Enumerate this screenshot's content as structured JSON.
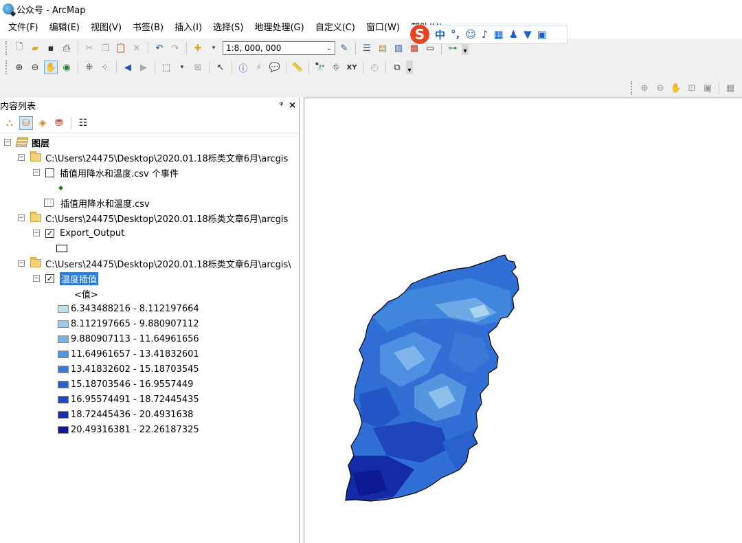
{
  "window": {
    "title": "公众号 - ArcMap"
  },
  "menu": [
    "文件(F)",
    "编辑(E)",
    "视图(V)",
    "书签(B)",
    "插入(I)",
    "选择(S)",
    "地理处理(G)",
    "自定义(C)",
    "窗口(W)",
    "帮助(H)"
  ],
  "ime": {
    "logo": "S",
    "mode": "中"
  },
  "toolbar": {
    "scale": "1:8, 000, 000"
  },
  "toc": {
    "title": "内容列表",
    "pin_glyph": "ᵠ",
    "close_glyph": "×",
    "root": "图层",
    "groups": [
      {
        "path": "C:\\Users\\24475\\Desktop\\2020.01.18栎类文章6月\\arcgis"
      },
      {
        "path": "C:\\Users\\24475\\Desktop\\2020.01.18栎类文章6月\\arcgis"
      },
      {
        "path": "C:\\Users\\24475\\Desktop\\2020.01.18栎类文章6月\\arcgis\\"
      }
    ],
    "events_layer": "插值用降水和温度.csv 个事件",
    "csv_table": "插值用降水和温度.csv",
    "export_layer": "Export_Output",
    "raster_layer": "温度插值",
    "value_heading": "<值>",
    "classes": [
      {
        "label": "6.343488216 - 8.112197664",
        "color": "#b5e3ec"
      },
      {
        "label": "8.112197665 - 9.880907112",
        "color": "#97cde9"
      },
      {
        "label": "9.880907113 - 11.64961656",
        "color": "#79b2e4"
      },
      {
        "label": "11.64961657 - 13.41832601",
        "color": "#5696de"
      },
      {
        "label": "13.41832602 - 15.18703545",
        "color": "#3a7ad8"
      },
      {
        "label": "15.18703546 - 16.9557449",
        "color": "#2a5fce"
      },
      {
        "label": "16.95574491 - 18.72445435",
        "color": "#1f45c0"
      },
      {
        "label": "18.72445436 - 20.4931638",
        "color": "#162ead"
      },
      {
        "label": "20.49316381 - 22.26187325",
        "color": "#0c1896"
      }
    ]
  }
}
